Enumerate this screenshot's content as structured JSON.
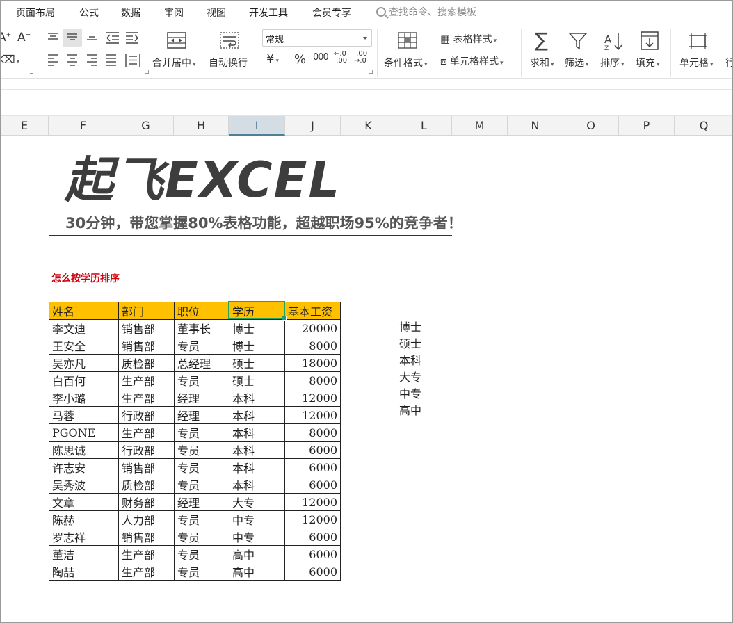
{
  "menu": [
    "页面布局",
    "公式",
    "数据",
    "审阅",
    "视图",
    "开发工具",
    "会员专享"
  ],
  "search": {
    "label": "查找命令、搜索模板",
    "icon": "search-icon"
  },
  "ribbon": {
    "font_grow": "A⁺",
    "font_shrink": "A⁻",
    "merge_center": "合并居中",
    "wrap_text": "自动换行",
    "number_format": "常规",
    "currency": "¥",
    "percent": "%",
    "thousands": "000",
    "dec_inc": "←.0 .00",
    "dec_dec": ".00 →.0",
    "conditional_format": "条件格式",
    "table_style": "表格样式",
    "cell_style": "单元格样式",
    "sum": "求和",
    "filter": "筛选",
    "sort": "排序",
    "fill": "填充",
    "cell": "单元格",
    "row_col_partial": "行"
  },
  "columns": [
    "E",
    "F",
    "G",
    "H",
    "I",
    "J",
    "K",
    "L",
    "M",
    "N",
    "O",
    "P",
    "Q"
  ],
  "selected_column": "I",
  "sheet": {
    "brand": "起飞EXCEL",
    "slogan": "30分钟，带您掌握80%表格功能，超越职场95%的竞争者！",
    "subtitle": "怎么按学历排序"
  },
  "table": {
    "headers": [
      "姓名",
      "部门",
      "职位",
      "学历",
      "基本工资"
    ],
    "rows": [
      [
        "李文迪",
        "销售部",
        "董事长",
        "博士",
        "20000"
      ],
      [
        "王安全",
        "销售部",
        "专员",
        "博士",
        "8000"
      ],
      [
        "吴亦凡",
        "质检部",
        "总经理",
        "硕士",
        "18000"
      ],
      [
        "白百何",
        "生产部",
        "专员",
        "硕士",
        "8000"
      ],
      [
        "李小璐",
        "生产部",
        "经理",
        "本科",
        "12000"
      ],
      [
        "马蓉",
        "行政部",
        "经理",
        "本科",
        "12000"
      ],
      [
        "PGONE",
        "生产部",
        "专员",
        "本科",
        "8000"
      ],
      [
        "陈思诚",
        "行政部",
        "专员",
        "本科",
        "6000"
      ],
      [
        "许志安",
        "销售部",
        "专员",
        "本科",
        "6000"
      ],
      [
        "吴秀波",
        "质检部",
        "专员",
        "本科",
        "6000"
      ],
      [
        "文章",
        "财务部",
        "经理",
        "大专",
        "12000"
      ],
      [
        "陈赫",
        "人力部",
        "专员",
        "中专",
        "12000"
      ],
      [
        "罗志祥",
        "销售部",
        "专员",
        "中专",
        "6000"
      ],
      [
        "董洁",
        "生产部",
        "专员",
        "高中",
        "6000"
      ],
      [
        "陶喆",
        "生产部",
        "专员",
        "高中",
        "6000"
      ]
    ]
  },
  "order_list": [
    "博士",
    "硕士",
    "本科",
    "大专",
    "中专",
    "高中"
  ],
  "colors": {
    "header_fill": "#ffc000",
    "subtitle": "#d0000b",
    "selection": "#21a366"
  }
}
